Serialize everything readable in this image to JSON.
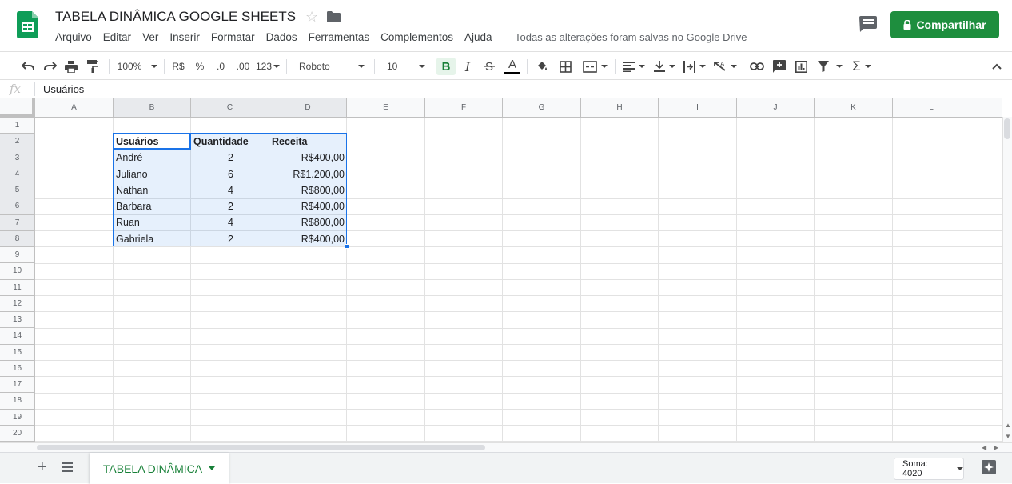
{
  "app": {
    "title": "TABELA DINÂMICA GOOGLE SHEETS",
    "save_status": "Todas as alterações foram salvas no Google Drive",
    "share_label": "Compartilhar",
    "accent_color": "#1e8e3e"
  },
  "menu": [
    "Arquivo",
    "Editar",
    "Ver",
    "Inserir",
    "Formatar",
    "Dados",
    "Ferramentas",
    "Complementos",
    "Ajuda"
  ],
  "toolbar": {
    "zoom": "100%",
    "currency": "R$",
    "percent": "%",
    "decrease_decimals": ".0",
    "increase_decimals": ".00",
    "more_formats": "123",
    "font": "Roboto",
    "font_size": "10",
    "bold": "B",
    "italic": "I",
    "text_color": "A",
    "icons": [
      "undo-icon",
      "redo-icon",
      "print-icon",
      "paint-format-icon",
      "strikethrough-icon",
      "fill-color-icon",
      "borders-icon",
      "merge-icon",
      "align-icon",
      "valign-icon",
      "wrap-icon",
      "rotate-icon",
      "link-icon",
      "comment-icon",
      "chart-icon",
      "filter-icon",
      "functions-icon",
      "collapse-icon"
    ]
  },
  "formula_bar": {
    "fx": "fx",
    "value": "Usuários"
  },
  "columns": [
    "A",
    "B",
    "C",
    "D",
    "E",
    "F",
    "G",
    "H",
    "I",
    "J",
    "K",
    "L"
  ],
  "rows": [
    "1",
    "2",
    "3",
    "4",
    "5",
    "6",
    "7",
    "8",
    "9",
    "10",
    "11",
    "12",
    "13",
    "14",
    "15",
    "16",
    "17",
    "18",
    "19",
    "20"
  ],
  "table": {
    "headers": [
      "Usuários",
      "Quantidade",
      "Receita"
    ],
    "rows": [
      {
        "user": "André",
        "qty": "2",
        "revenue": "R$400,00"
      },
      {
        "user": "Juliano",
        "qty": "6",
        "revenue": "R$1.200,00"
      },
      {
        "user": "Nathan",
        "qty": "4",
        "revenue": "R$800,00"
      },
      {
        "user": "Barbara",
        "qty": "2",
        "revenue": "R$400,00"
      },
      {
        "user": "Ruan",
        "qty": "4",
        "revenue": "R$800,00"
      },
      {
        "user": "Gabriela",
        "qty": "2",
        "revenue": "R$400,00"
      }
    ]
  },
  "bottom": {
    "sheet_tab": "TABELA DINÂMICA",
    "sum": "Soma: 4020"
  }
}
